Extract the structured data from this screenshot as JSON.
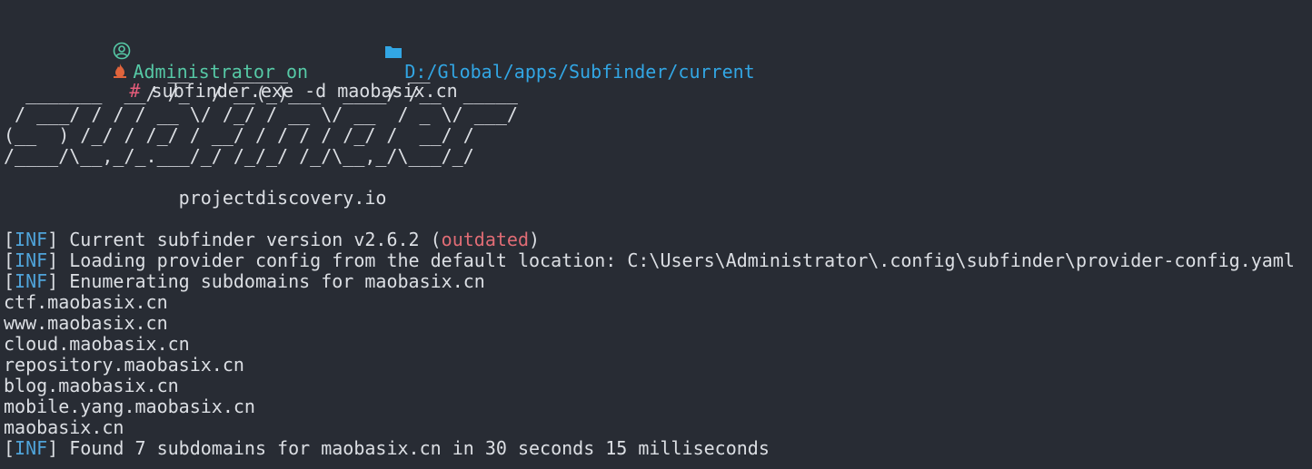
{
  "prompt": {
    "user_line": "Administrator on ",
    "path": "D:/Global/apps/Subfinder/current",
    "hash": "#",
    "command": " subfinder.exe -d maobasix.cn",
    "colors": {
      "user": "#56c9a6",
      "path": "#32a6e4",
      "hash": "#e55c7a"
    },
    "icons": [
      "user-circle-icon",
      "folder-icon",
      "flame-icon"
    ]
  },
  "banner": {
    "lines": [
      "               __    _____           __",
      "  _______  __/ /_  / __(_)___  ____/ /__  _____",
      " / ___/ / / / __ \\/ /_/ / __ \\/ __  / _ \\/ ___/",
      "(__  ) /_/ / /_/ / __/ / / / / /_/ /  __/ /",
      "/____/\\__,_/_.___/_/ /_/_/ /_/\\__,_/\\___/_/"
    ],
    "site": "                projectdiscovery.io"
  },
  "log": {
    "tag_open": "[",
    "tag": "INF",
    "tag_close": "]",
    "version_text": " Current subfinder version v2.6.2 (",
    "version_status": "outdated",
    "version_close": ")",
    "config_text": " Loading provider config from the default location: C:\\Users\\Administrator\\.config\\subfinder\\provider-config.yaml",
    "enum_text": " Enumerating subdomains for maobasix.cn",
    "found_text": " Found 7 subdomains for maobasix.cn in 30 seconds 15 milliseconds"
  },
  "subdomains": [
    "ctf.maobasix.cn",
    "www.maobasix.cn",
    "cloud.maobasix.cn",
    "repository.maobasix.cn",
    "blog.maobasix.cn",
    "mobile.yang.maobasix.cn",
    "maobasix.cn"
  ]
}
